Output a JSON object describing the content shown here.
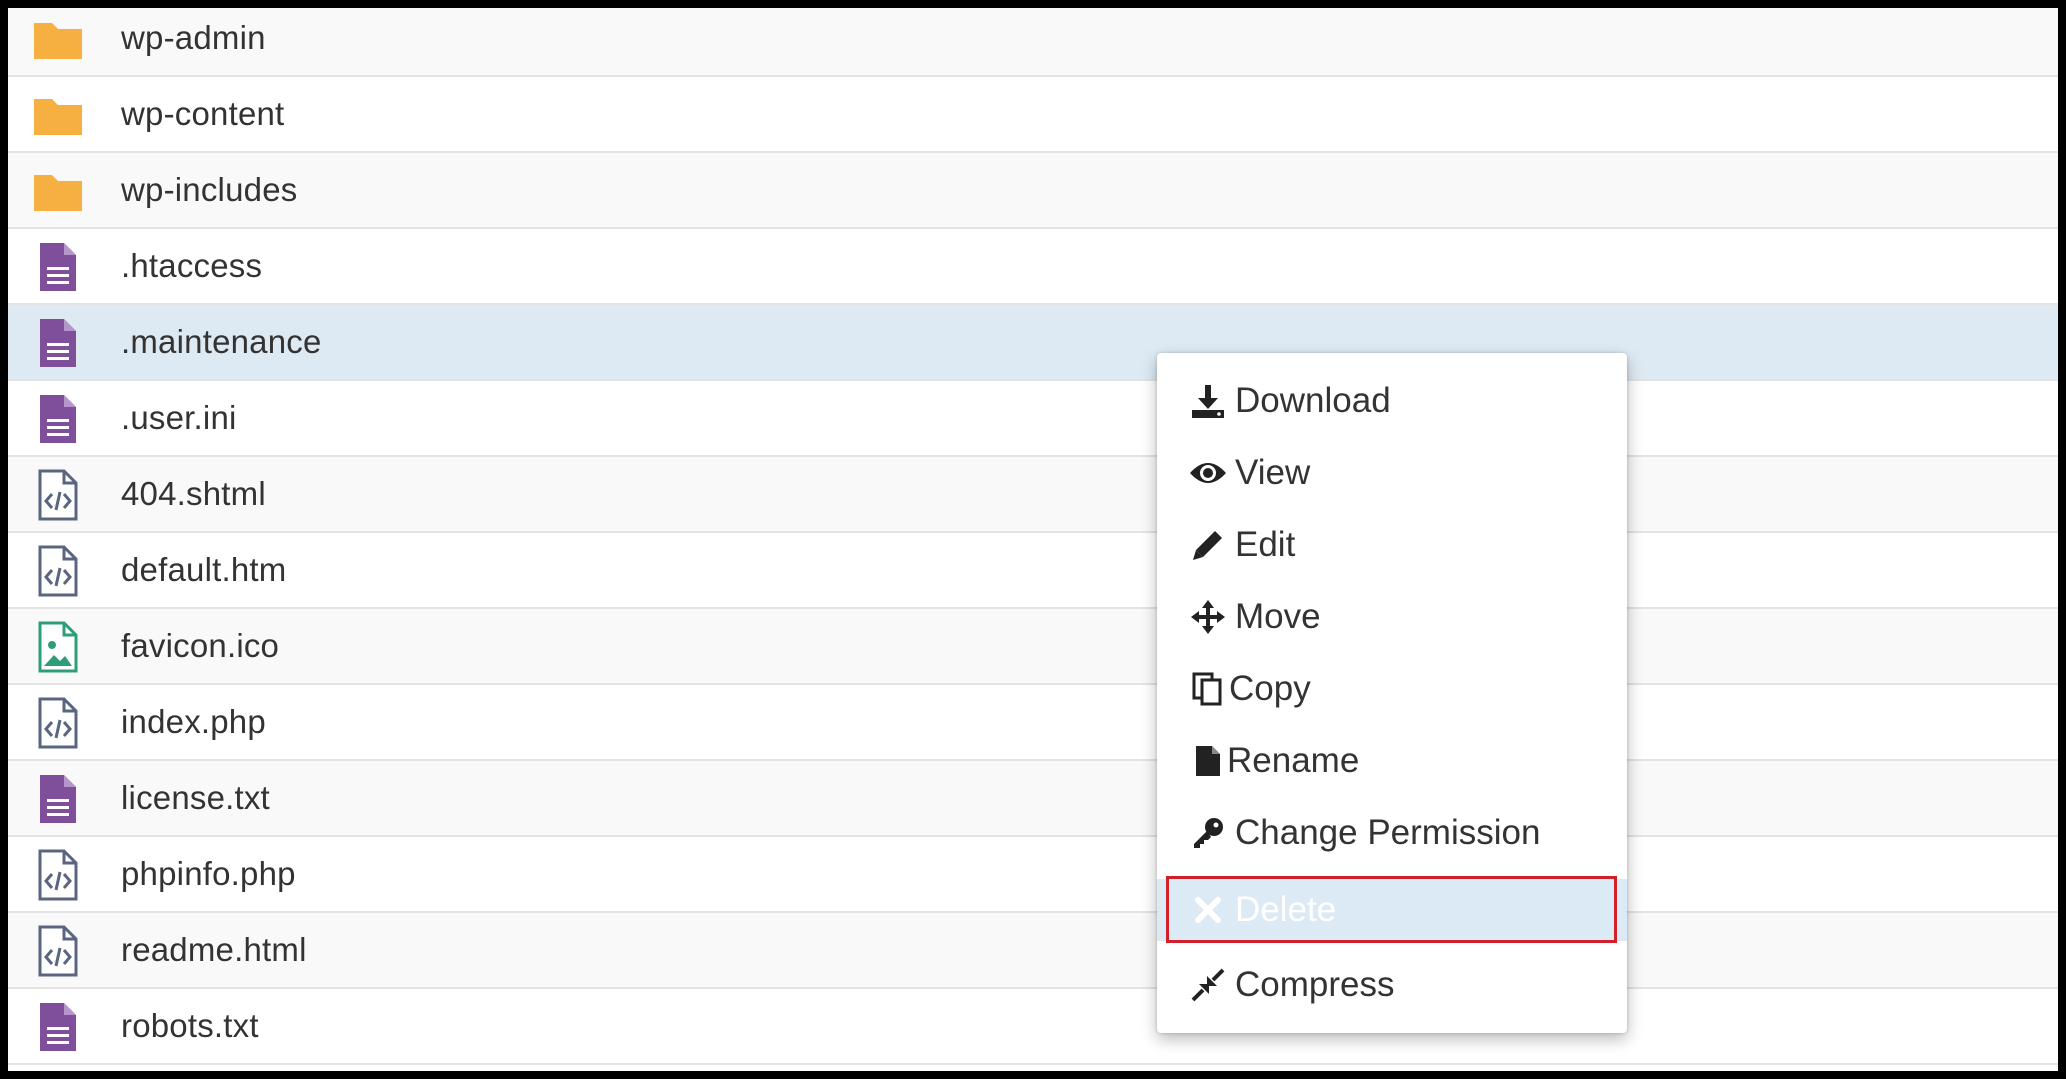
{
  "files": [
    {
      "name": "wp-admin",
      "type": "folder",
      "icon": "folder-icon"
    },
    {
      "name": "wp-content",
      "type": "folder",
      "icon": "folder-icon"
    },
    {
      "name": "wp-includes",
      "type": "folder",
      "icon": "folder-icon"
    },
    {
      "name": ".htaccess",
      "type": "text",
      "icon": "text-file-icon"
    },
    {
      "name": ".maintenance",
      "type": "text",
      "icon": "text-file-icon",
      "selected": true
    },
    {
      "name": ".user.ini",
      "type": "text",
      "icon": "text-file-icon"
    },
    {
      "name": "404.shtml",
      "type": "code",
      "icon": "code-file-icon"
    },
    {
      "name": "default.htm",
      "type": "code",
      "icon": "code-file-icon"
    },
    {
      "name": "favicon.ico",
      "type": "image",
      "icon": "image-file-icon"
    },
    {
      "name": "index.php",
      "type": "code",
      "icon": "code-file-icon"
    },
    {
      "name": "license.txt",
      "type": "text",
      "icon": "text-file-icon"
    },
    {
      "name": "phpinfo.php",
      "type": "code",
      "icon": "code-file-icon"
    },
    {
      "name": "readme.html",
      "type": "code",
      "icon": "code-file-icon"
    },
    {
      "name": "robots.txt",
      "type": "text",
      "icon": "text-file-icon"
    }
  ],
  "context_menu": {
    "items": [
      {
        "label": "Download",
        "icon": "download-icon"
      },
      {
        "label": "View",
        "icon": "eye-icon"
      },
      {
        "label": "Edit",
        "icon": "pencil-icon"
      },
      {
        "label": "Move",
        "icon": "move-arrows-icon"
      },
      {
        "label": "Copy",
        "icon": "copy-icon"
      },
      {
        "label": "Rename",
        "icon": "file-icon"
      },
      {
        "label": "Change Permission",
        "icon": "key-icon"
      },
      {
        "label": "Delete",
        "icon": "close-icon",
        "highlighted": true
      },
      {
        "label": "Compress",
        "icon": "compress-icon"
      }
    ]
  },
  "colors": {
    "folder": "#f5b041",
    "text_file": "#7f4f9c",
    "code_file": "#5a6680",
    "image_file": "#2e9e78",
    "selected_row": "#deeaf3",
    "highlight_box": "#d0202a"
  }
}
